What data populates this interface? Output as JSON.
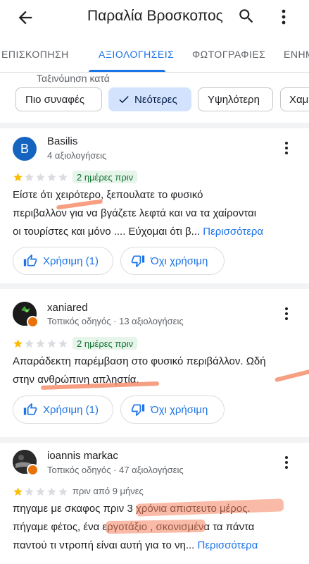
{
  "app_bar": {
    "title": "Παραλία Βροσκοπος",
    "back_icon": "arrow-back-icon",
    "search_icon": "search-icon",
    "more_icon": "more-vert-icon"
  },
  "tabs": [
    {
      "label": "ΕΠΙΣΚΟΠΗΣΗ",
      "active": false
    },
    {
      "label": "ΑΞΙΟΛΟΓΗΣΕΙΣ",
      "active": true
    },
    {
      "label": "ΦΩΤΟΓΡΑΦΙΕΣ",
      "active": false
    },
    {
      "label": "ΕΝΗΜ",
      "active": false
    }
  ],
  "partial_section_title": "Ταξινόμηση κατά",
  "sort_chips": [
    {
      "label": "Πιο συναφές",
      "selected": false
    },
    {
      "label": "Νεότερες",
      "selected": true
    },
    {
      "label": "Υψηλότερη",
      "selected": false
    },
    {
      "label": "Χαμ",
      "selected": false
    }
  ],
  "colors": {
    "accent": "#1a73e8",
    "star": "#fbbc04",
    "badge_bg": "#e6f4ea",
    "badge_text": "#137333",
    "annotation": "#f4845f"
  },
  "reviews": [
    {
      "author": "Basilis",
      "avatar_letter": "B",
      "meta": "4 αξιολογήσεις",
      "rating": 1,
      "date": "2 ημέρες πριν",
      "lines": [
        "Είστε ότι χειρότερο, ξεπουλατε το φυσικό",
        "περιβαλλον για να βγάζετε λεφτά και να τα χαίρονται",
        "οι τουρίστες και μόνο .... Εύχομαι ότι β..."
      ],
      "more_label": "Περισσότερα",
      "helpful_label": "Χρήσιμη (1)",
      "not_helpful_label": "Όχι χρήσιμη"
    },
    {
      "author": "xaniared",
      "meta": "Τοπικός οδηγός · 13 αξιολογήσεις",
      "rating": 1,
      "date": "2 ημέρες πριν",
      "lines": [
        "Απαράδεκτη παρέμβαση στο φυσικό περιβάλλον. Ωδή",
        "στην ανθρώπινη απληστία."
      ],
      "helpful_label": "Χρήσιμη (1)",
      "not_helpful_label": "Όχι χρήσιμη"
    },
    {
      "author": "ioannis markac",
      "meta": "Τοπικός οδηγός · 47 αξιολογήσεις",
      "rating": 1,
      "date": "πριν από 9 μήνες",
      "lines": [
        "πηγαμε με σκαφος πριν 3 χρόνια απιστευτο μέρος.",
        "πήγαμε φέτος, ένα εργοτάξιο , σκονισμένα τα πάντα",
        "παντού τι ντροπή είναι αυτή  για το νη..."
      ],
      "more_label": "Περισσότερα"
    }
  ]
}
